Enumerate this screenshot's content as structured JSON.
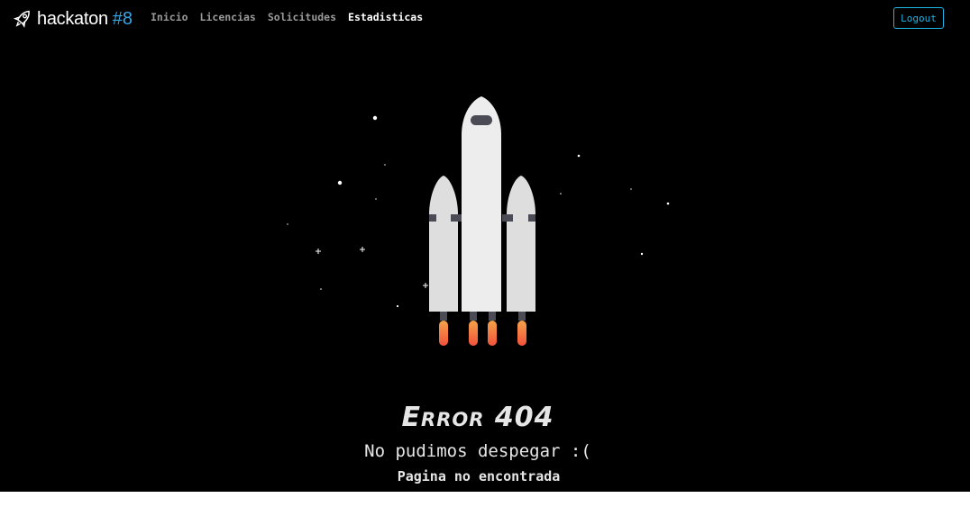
{
  "navbar": {
    "brand_text": "hackaton",
    "brand_number": "#8",
    "brand_icon": "rocket-icon",
    "links": [
      {
        "label": "Inicio",
        "active": false
      },
      {
        "label": "Licencias",
        "active": false
      },
      {
        "label": "Solicitudes",
        "active": false
      },
      {
        "label": "Estadisticas",
        "active": true
      }
    ],
    "logout_label": "Logout"
  },
  "error": {
    "title": "Error 404",
    "subtitle": "No pudimos despegar :(",
    "detail": "Pagina no encontrada"
  },
  "illustration": {
    "subject": "rocket-illustration",
    "star_icon": "star-icon"
  },
  "colors": {
    "background": "#000000",
    "accent": "#1fb6e8",
    "brand_number": "#3aa6e6",
    "nav_inactive": "#9a9a9a",
    "nav_active": "#ffffff",
    "rocket_body": "#ededed",
    "booster_body": "#dedede",
    "rocket_detail": "#4b4b55",
    "flame_top": "#f6a24a",
    "flame_bottom": "#f0523a"
  }
}
